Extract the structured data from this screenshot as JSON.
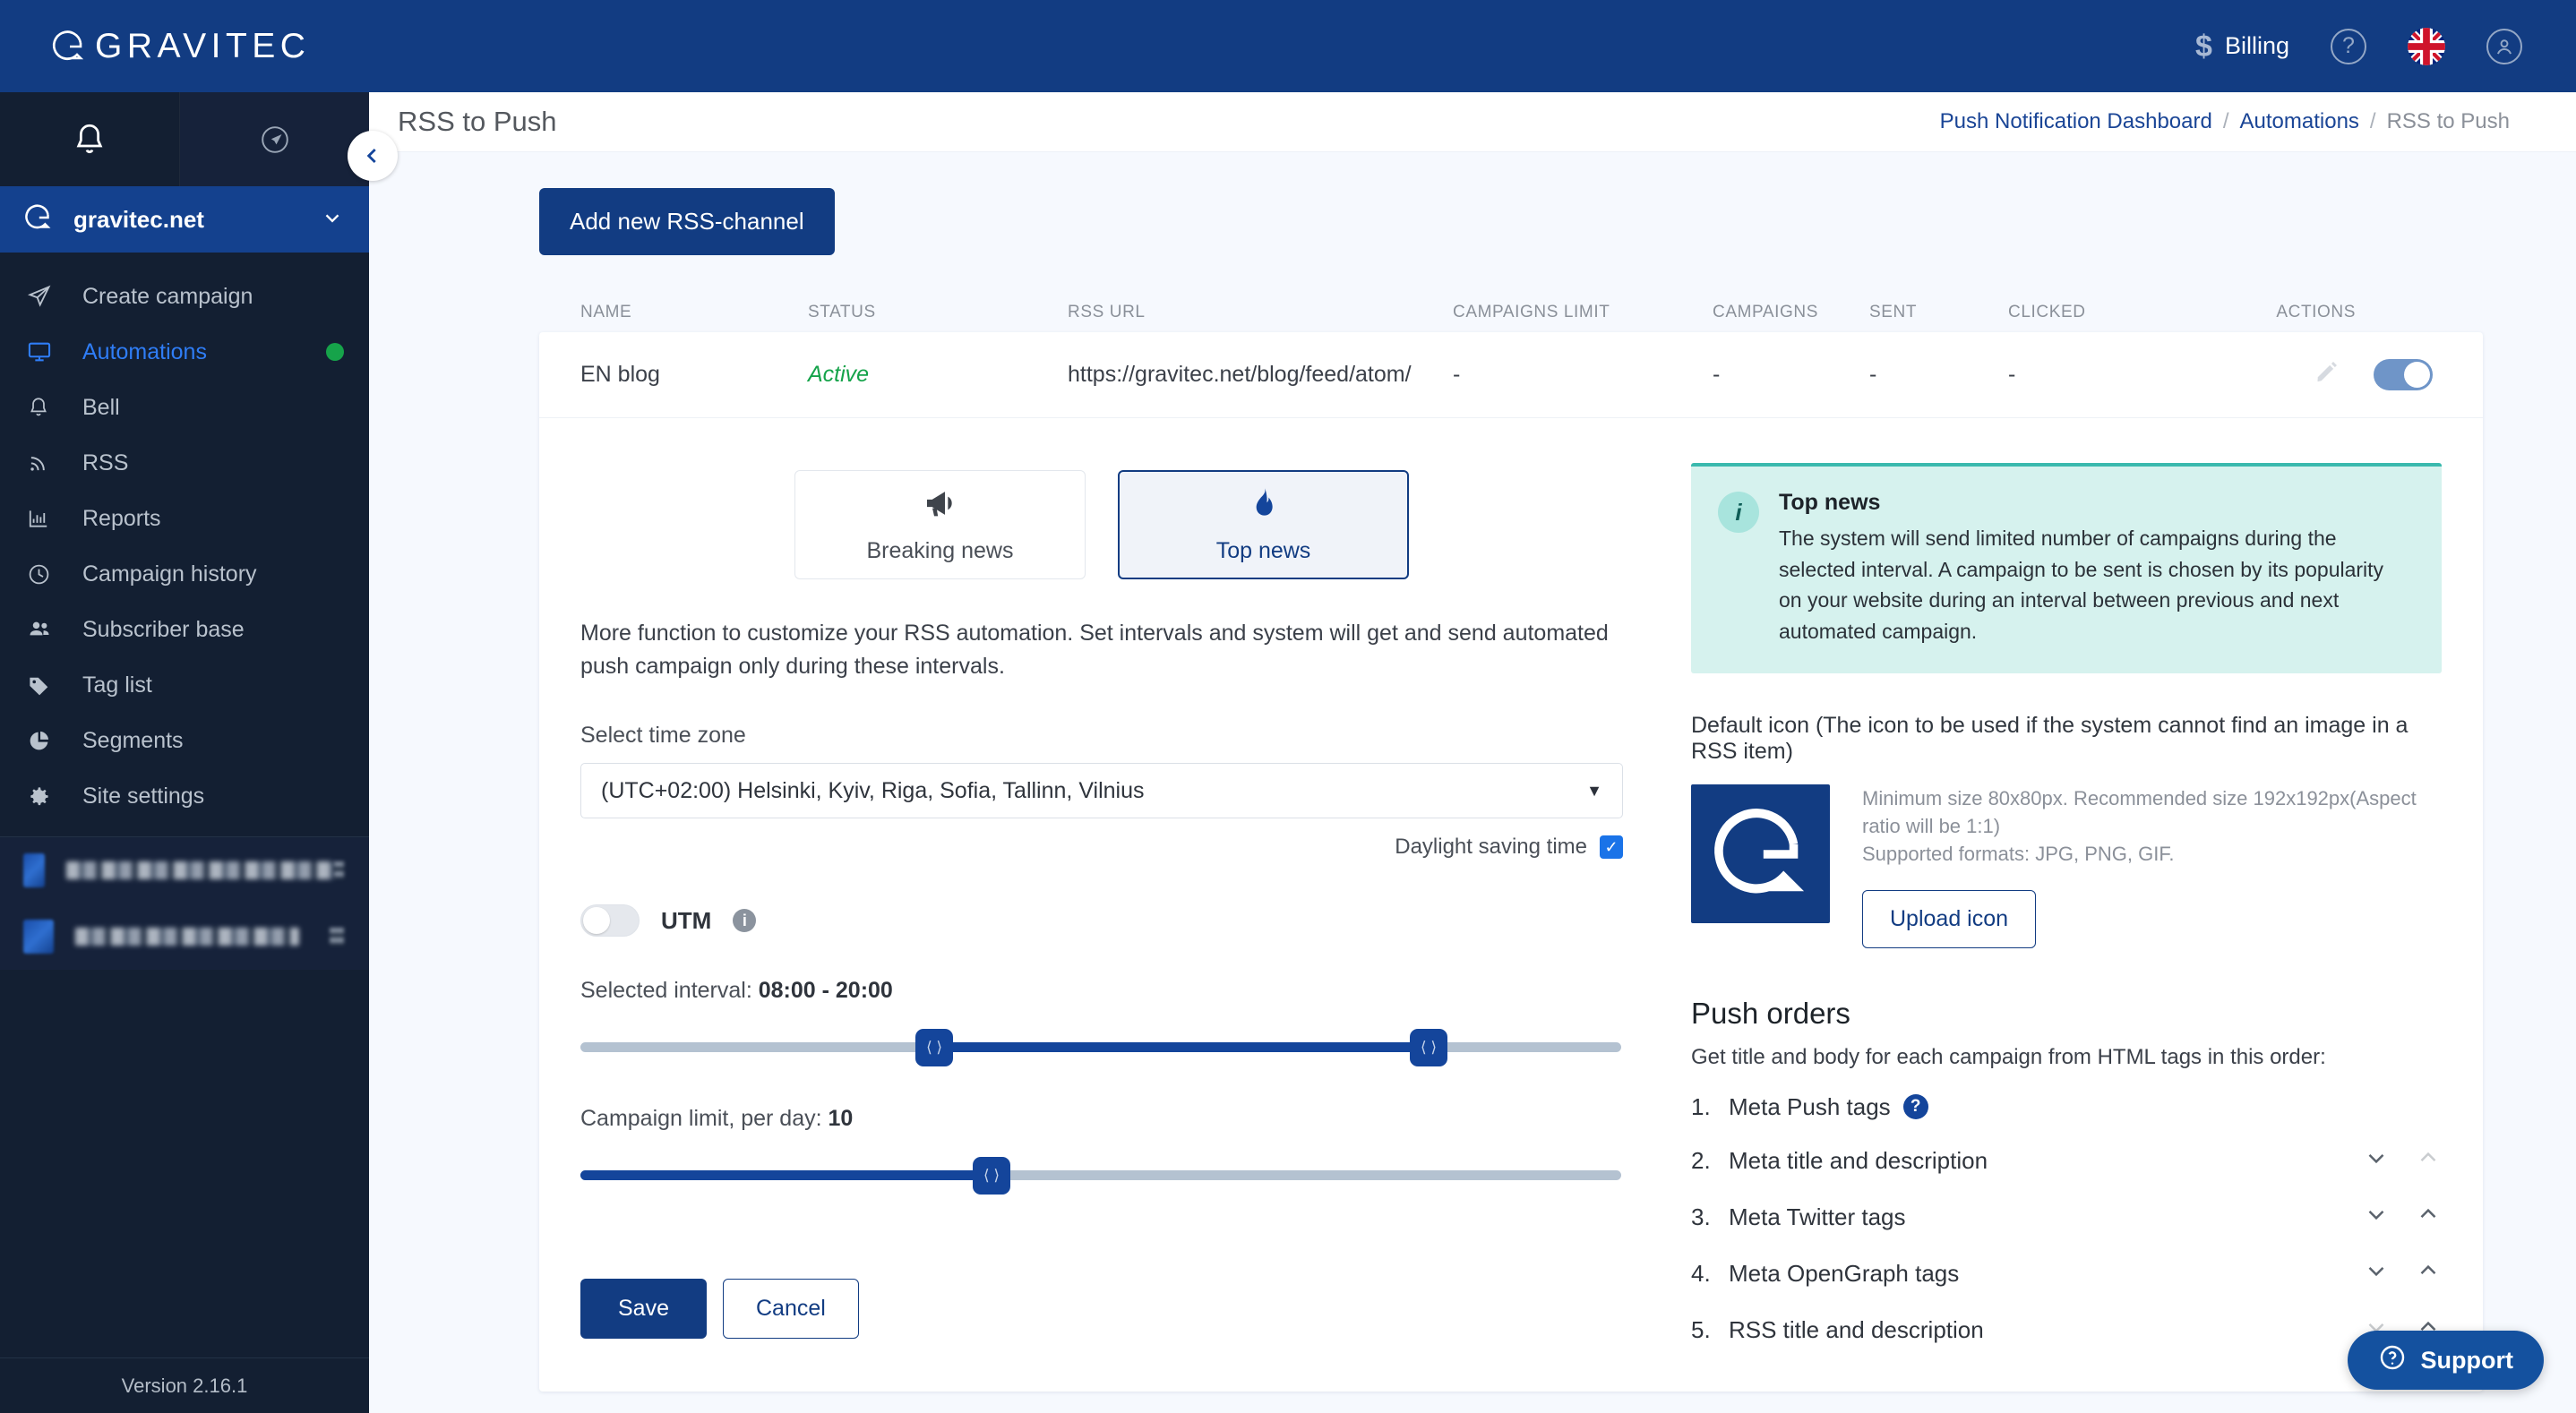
{
  "topbar": {
    "brand": "GRAVITEC",
    "billing_label": "Billing",
    "dollar_icon": "dollar-icon",
    "help_icon": "help-circle-icon",
    "flag_icon": "uk-flag-icon",
    "account_icon": "account-circle-icon"
  },
  "sidebar": {
    "bell_icon": "bell-icon",
    "send_icon": "send-circle-icon",
    "collapse_icon": "chevron-left-icon",
    "site_name": "gravitec.net",
    "items": [
      {
        "label": "Create campaign",
        "icon": "paper-plane-icon",
        "active": false,
        "badge": false
      },
      {
        "label": "Automations",
        "icon": "monitor-icon",
        "active": true,
        "badge": true
      },
      {
        "label": "Bell",
        "icon": "bell-outline-icon",
        "active": false,
        "badge": false
      },
      {
        "label": "RSS",
        "icon": "rss-icon",
        "active": false,
        "badge": false
      },
      {
        "label": "Reports",
        "icon": "bar-chart-icon",
        "active": false,
        "badge": false
      },
      {
        "label": "Campaign history",
        "icon": "clock-icon",
        "active": false,
        "badge": false
      },
      {
        "label": "Subscriber base",
        "icon": "users-icon",
        "active": false,
        "badge": false
      },
      {
        "label": "Tag list",
        "icon": "tag-icon",
        "active": false,
        "badge": false
      },
      {
        "label": "Segments",
        "icon": "pie-chart-icon",
        "active": false,
        "badge": false
      },
      {
        "label": "Site settings",
        "icon": "gear-icon",
        "active": false,
        "badge": false
      }
    ],
    "other_sites": [
      {
        "label": "",
        "redacted": true
      },
      {
        "label": "",
        "redacted": true
      }
    ],
    "version": "Version 2.16.1"
  },
  "page": {
    "title": "RSS to Push",
    "breadcrumb": [
      {
        "label": "Push Notification Dashboard",
        "link": true
      },
      {
        "label": "Automations",
        "link": true
      },
      {
        "label": "RSS to Push",
        "link": false
      }
    ],
    "separator": "/"
  },
  "toolbar": {
    "add_channel_label": "Add new RSS-channel"
  },
  "table": {
    "columns": [
      "NAME",
      "STATUS",
      "RSS URL",
      "CAMPAIGNS LIMIT",
      "CAMPAIGNS",
      "SENT",
      "CLICKED",
      "ACTIONS"
    ],
    "rows": [
      {
        "name": "EN blog",
        "status": "Active",
        "url": "https://gravitec.net/blog/feed/atom/",
        "campaigns_limit": "-",
        "campaigns": "-",
        "sent": "-",
        "clicked": "-",
        "edit_icon": "pencil-icon",
        "toggle_on": true
      }
    ]
  },
  "detail": {
    "types": [
      {
        "label": "Breaking news",
        "icon": "megaphone-icon",
        "selected": false
      },
      {
        "label": "Top news",
        "icon": "flame-icon",
        "selected": true
      }
    ],
    "description": "More function to customize your RSS automation. Set intervals and system will get and send automated push campaign only during these intervals.",
    "timezone_label": "Select time zone",
    "timezone_value": "(UTC+02:00) Helsinki, Kyiv, Riga, Sofia, Tallinn, Vilnius",
    "timezone_caret": "chevron-down-icon",
    "daylight_label": "Daylight saving time",
    "daylight_checked": true,
    "utm_label": "UTM",
    "utm_info_icon": "info-icon",
    "utm_enabled": false,
    "interval_label": "Selected interval:",
    "interval_value": "08:00 - 20:00",
    "interval_start_pct": 34,
    "interval_end_pct": 81.5,
    "limit_label": "Campaign limit, per day:",
    "limit_value": "10",
    "limit_pct": 39.5,
    "handle_glyph": "⟨ ⟩",
    "save_label": "Save",
    "cancel_label": "Cancel"
  },
  "right": {
    "callout": {
      "icon": "info-icon",
      "title": "Top news",
      "body": "The system will send limited number of campaigns during the selected interval. A campaign to be sent is chosen by its popularity on your website during an interval between previous and next automated campaign."
    },
    "default_icon_title": "Default icon (The icon to be used if the system cannot find an image in a RSS item)",
    "icon_hint_line1": "Minimum size 80x80px. Recommended size 192x192px(Aspect ratio will be 1:1)",
    "icon_hint_line2": "Supported formats: JPG, PNG, GIF.",
    "upload_label": "Upload icon",
    "push_orders_title": "Push orders",
    "push_orders_sub": "Get title and body for each campaign from HTML tags in this order:",
    "orders": [
      {
        "num": "1.",
        "label": "Meta Push tags",
        "help": true,
        "down": false,
        "up": false,
        "down_dim": false,
        "up_dim": false
      },
      {
        "num": "2.",
        "label": "Meta title and description",
        "help": false,
        "down": true,
        "up": true,
        "down_dim": false,
        "up_dim": true
      },
      {
        "num": "3.",
        "label": "Meta Twitter tags",
        "help": false,
        "down": true,
        "up": true,
        "down_dim": false,
        "up_dim": false
      },
      {
        "num": "4.",
        "label": "Meta OpenGraph tags",
        "help": false,
        "down": true,
        "up": true,
        "down_dim": false,
        "up_dim": false
      },
      {
        "num": "5.",
        "label": "RSS title and description",
        "help": false,
        "down": true,
        "up": true,
        "down_dim": true,
        "up_dim": false
      }
    ]
  },
  "support": {
    "label": "Support",
    "icon": "help-circle-icon"
  },
  "colors": {
    "brand_navy": "#123c82",
    "sidebar_dark": "#131f32",
    "accent_blue": "#2f7df6",
    "status_green": "#15a34a",
    "callout_teal": "#3ab9ae",
    "slider_blue": "#14459b"
  }
}
